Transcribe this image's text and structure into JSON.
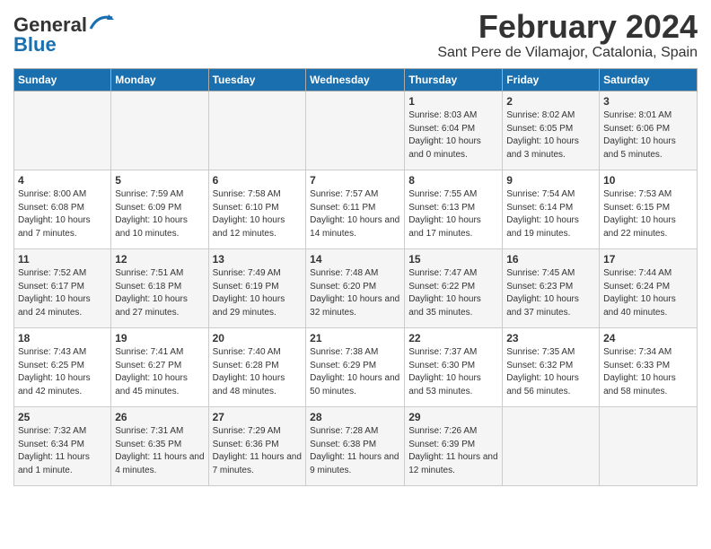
{
  "logo": {
    "line1": "General",
    "line2": "Blue"
  },
  "title": "February 2024",
  "location": "Sant Pere de Vilamajor, Catalonia, Spain",
  "headers": [
    "Sunday",
    "Monday",
    "Tuesday",
    "Wednesday",
    "Thursday",
    "Friday",
    "Saturday"
  ],
  "weeks": [
    [
      {
        "day": "",
        "info": ""
      },
      {
        "day": "",
        "info": ""
      },
      {
        "day": "",
        "info": ""
      },
      {
        "day": "",
        "info": ""
      },
      {
        "day": "1",
        "info": "Sunrise: 8:03 AM\nSunset: 6:04 PM\nDaylight: 10 hours and 0 minutes."
      },
      {
        "day": "2",
        "info": "Sunrise: 8:02 AM\nSunset: 6:05 PM\nDaylight: 10 hours and 3 minutes."
      },
      {
        "day": "3",
        "info": "Sunrise: 8:01 AM\nSunset: 6:06 PM\nDaylight: 10 hours and 5 minutes."
      }
    ],
    [
      {
        "day": "4",
        "info": "Sunrise: 8:00 AM\nSunset: 6:08 PM\nDaylight: 10 hours and 7 minutes."
      },
      {
        "day": "5",
        "info": "Sunrise: 7:59 AM\nSunset: 6:09 PM\nDaylight: 10 hours and 10 minutes."
      },
      {
        "day": "6",
        "info": "Sunrise: 7:58 AM\nSunset: 6:10 PM\nDaylight: 10 hours and 12 minutes."
      },
      {
        "day": "7",
        "info": "Sunrise: 7:57 AM\nSunset: 6:11 PM\nDaylight: 10 hours and 14 minutes."
      },
      {
        "day": "8",
        "info": "Sunrise: 7:55 AM\nSunset: 6:13 PM\nDaylight: 10 hours and 17 minutes."
      },
      {
        "day": "9",
        "info": "Sunrise: 7:54 AM\nSunset: 6:14 PM\nDaylight: 10 hours and 19 minutes."
      },
      {
        "day": "10",
        "info": "Sunrise: 7:53 AM\nSunset: 6:15 PM\nDaylight: 10 hours and 22 minutes."
      }
    ],
    [
      {
        "day": "11",
        "info": "Sunrise: 7:52 AM\nSunset: 6:17 PM\nDaylight: 10 hours and 24 minutes."
      },
      {
        "day": "12",
        "info": "Sunrise: 7:51 AM\nSunset: 6:18 PM\nDaylight: 10 hours and 27 minutes."
      },
      {
        "day": "13",
        "info": "Sunrise: 7:49 AM\nSunset: 6:19 PM\nDaylight: 10 hours and 29 minutes."
      },
      {
        "day": "14",
        "info": "Sunrise: 7:48 AM\nSunset: 6:20 PM\nDaylight: 10 hours and 32 minutes."
      },
      {
        "day": "15",
        "info": "Sunrise: 7:47 AM\nSunset: 6:22 PM\nDaylight: 10 hours and 35 minutes."
      },
      {
        "day": "16",
        "info": "Sunrise: 7:45 AM\nSunset: 6:23 PM\nDaylight: 10 hours and 37 minutes."
      },
      {
        "day": "17",
        "info": "Sunrise: 7:44 AM\nSunset: 6:24 PM\nDaylight: 10 hours and 40 minutes."
      }
    ],
    [
      {
        "day": "18",
        "info": "Sunrise: 7:43 AM\nSunset: 6:25 PM\nDaylight: 10 hours and 42 minutes."
      },
      {
        "day": "19",
        "info": "Sunrise: 7:41 AM\nSunset: 6:27 PM\nDaylight: 10 hours and 45 minutes."
      },
      {
        "day": "20",
        "info": "Sunrise: 7:40 AM\nSunset: 6:28 PM\nDaylight: 10 hours and 48 minutes."
      },
      {
        "day": "21",
        "info": "Sunrise: 7:38 AM\nSunset: 6:29 PM\nDaylight: 10 hours and 50 minutes."
      },
      {
        "day": "22",
        "info": "Sunrise: 7:37 AM\nSunset: 6:30 PM\nDaylight: 10 hours and 53 minutes."
      },
      {
        "day": "23",
        "info": "Sunrise: 7:35 AM\nSunset: 6:32 PM\nDaylight: 10 hours and 56 minutes."
      },
      {
        "day": "24",
        "info": "Sunrise: 7:34 AM\nSunset: 6:33 PM\nDaylight: 10 hours and 58 minutes."
      }
    ],
    [
      {
        "day": "25",
        "info": "Sunrise: 7:32 AM\nSunset: 6:34 PM\nDaylight: 11 hours and 1 minute."
      },
      {
        "day": "26",
        "info": "Sunrise: 7:31 AM\nSunset: 6:35 PM\nDaylight: 11 hours and 4 minutes."
      },
      {
        "day": "27",
        "info": "Sunrise: 7:29 AM\nSunset: 6:36 PM\nDaylight: 11 hours and 7 minutes."
      },
      {
        "day": "28",
        "info": "Sunrise: 7:28 AM\nSunset: 6:38 PM\nDaylight: 11 hours and 9 minutes."
      },
      {
        "day": "29",
        "info": "Sunrise: 7:26 AM\nSunset: 6:39 PM\nDaylight: 11 hours and 12 minutes."
      },
      {
        "day": "",
        "info": ""
      },
      {
        "day": "",
        "info": ""
      }
    ]
  ]
}
